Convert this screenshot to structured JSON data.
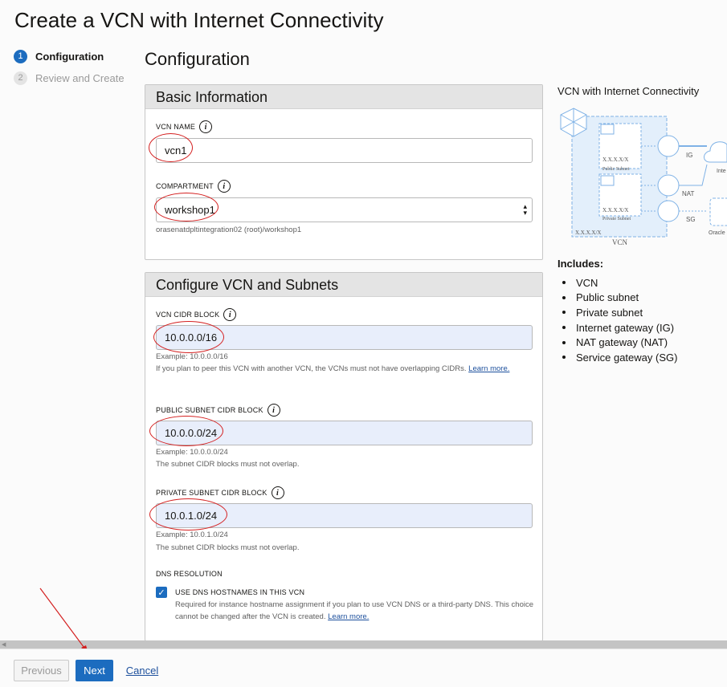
{
  "dialog": {
    "title": "Create a VCN with Internet Connectivity"
  },
  "steps": [
    {
      "num": "1",
      "label": "Configuration",
      "active": true
    },
    {
      "num": "2",
      "label": "Review and Create",
      "active": false
    }
  ],
  "main": {
    "heading": "Configuration"
  },
  "basic_info": {
    "title": "Basic Information",
    "vcn_name_label": "VCN NAME",
    "vcn_name_value": "vcn1",
    "compartment_label": "COMPARTMENT",
    "compartment_value": "workshop1",
    "compartment_path": "orasenatdpltintegration02 (root)/workshop1"
  },
  "configure": {
    "title": "Configure VCN and Subnets",
    "vcn_cidr_label": "VCN CIDR BLOCK",
    "vcn_cidr_value": "10.0.0.0/16",
    "vcn_cidr_example": "Example: 10.0.0.0/16",
    "vcn_cidr_note": "If you plan to peer this VCN with another VCN, the VCNs must not have overlapping CIDRs.",
    "learn_more": "Learn more.",
    "public_label": "PUBLIC SUBNET CIDR BLOCK",
    "public_value": "10.0.0.0/24",
    "public_example": "Example: 10.0.0.0/24",
    "public_note": "The subnet CIDR blocks must not overlap.",
    "private_label": "PRIVATE SUBNET CIDR BLOCK",
    "private_value": "10.0.1.0/24",
    "private_example": "Example: 10.0.1.0/24",
    "private_note": "The subnet CIDR blocks must not overlap.",
    "dns_label": "DNS RESOLUTION",
    "dns_checkbox_label": "USE DNS HOSTNAMES IN THIS VCN",
    "dns_note": "Required for instance hostname assignment if you plan to use VCN DNS or a third-party DNS. This choice cannot be changed after the VCN is created.",
    "dns_learn_more": "Learn more.",
    "dns_checked": true
  },
  "diagram": {
    "title": "VCN with Internet Connectivity",
    "cidr_top": "X.X.X.X/X",
    "cidr_bottom": "X.X.X.X/X",
    "public_subnet": "Public Subnet",
    "private_subnet": "Private Subnet",
    "vcn_cidr": "X.X.X.X/X",
    "vcn": "VCN",
    "ig": "IG",
    "nat": "NAT",
    "sg": "SG",
    "internet": "Inte",
    "oracle": "Oracle",
    "accent_color": "#7fb2e6"
  },
  "includes": {
    "title": "Includes:",
    "items": [
      "VCN",
      "Public subnet",
      "Private subnet",
      "Internet gateway (IG)",
      "NAT gateway (NAT)",
      "Service gateway (SG)"
    ]
  },
  "footer": {
    "previous": "Previous",
    "next": "Next",
    "cancel": "Cancel"
  },
  "colors": {
    "primary": "#1c6cbf",
    "annotation": "#d42020",
    "link": "#1c4f9c"
  }
}
